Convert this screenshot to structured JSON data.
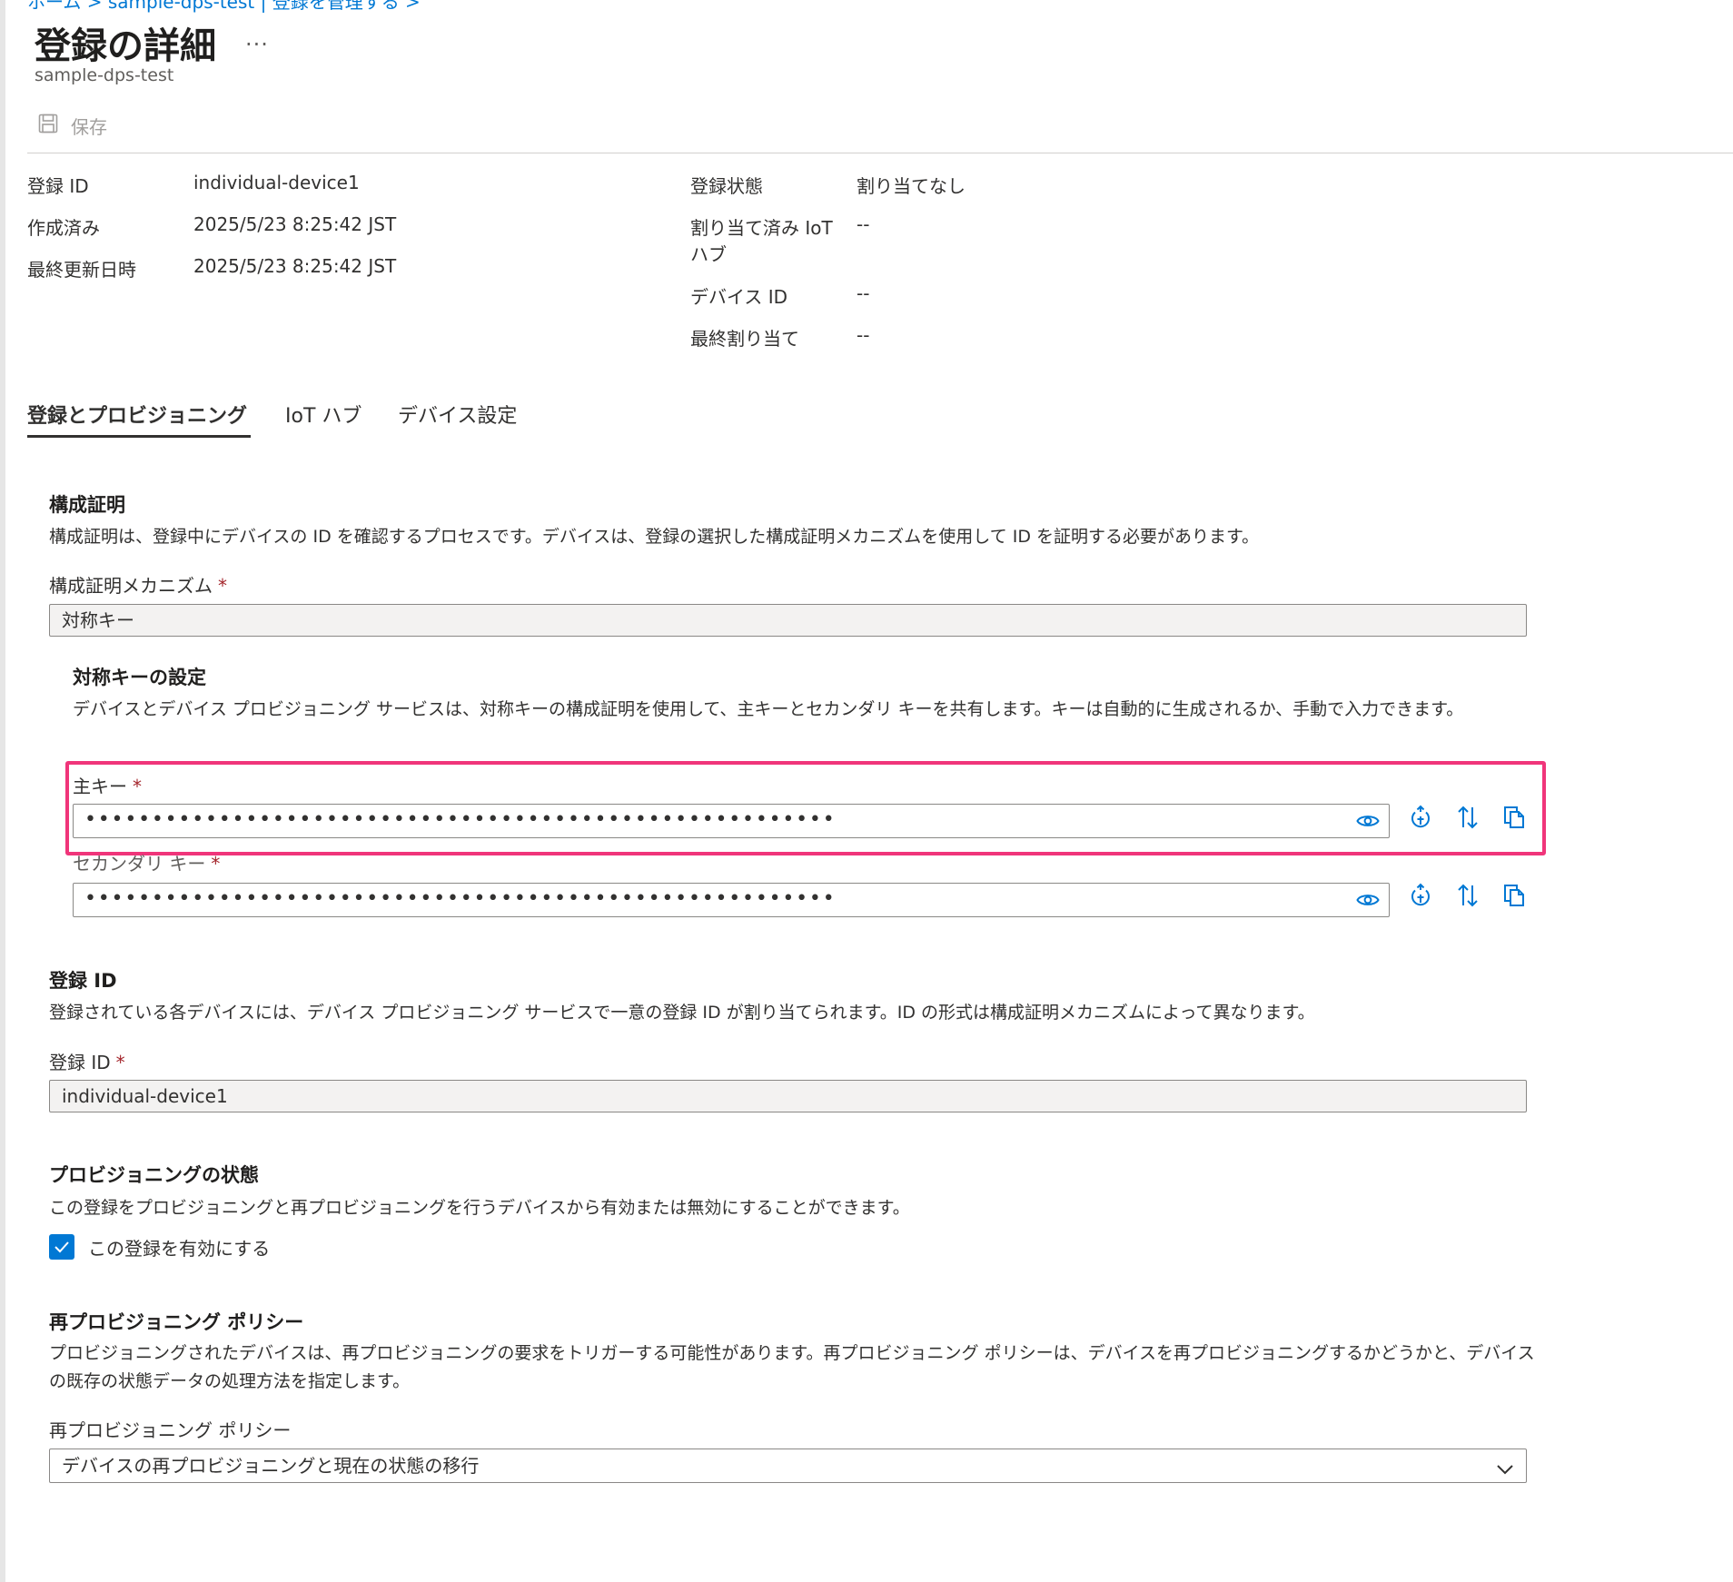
{
  "breadcrumb": {
    "text": "ホーム > sample-dps-test | 登録を管理する >"
  },
  "header": {
    "title": "登録の詳細",
    "more_label": "...",
    "subtitle": "sample-dps-test"
  },
  "toolbar": {
    "save_label": "保存"
  },
  "essentials": {
    "left": [
      {
        "label": "登録 ID",
        "value": "individual-device1"
      },
      {
        "label": "作成済み",
        "value": "2025/5/23 8:25:42 JST"
      },
      {
        "label": "最終更新日時",
        "value": "2025/5/23 8:25:42 JST"
      }
    ],
    "right": [
      {
        "label": "登録状態",
        "value": "割り当てなし"
      },
      {
        "label_line1": "割り当て済み IoT",
        "label_line2": "ハブ",
        "value": "--"
      },
      {
        "label": "デバイス ID",
        "value": "--"
      },
      {
        "label": "最終割り当て",
        "value": "--"
      }
    ]
  },
  "tabs": [
    {
      "label": "登録とプロビジョニング",
      "active": true
    },
    {
      "label": "IoT ハブ",
      "active": false
    },
    {
      "label": "デバイス設定",
      "active": false
    }
  ],
  "attestation": {
    "heading": "構成証明",
    "description": "構成証明は、登録中にデバイスの ID を確認するプロセスです。デバイスは、登録の選択した構成証明メカニズムを使用して ID を証明する必要があります。",
    "mechanism_label": "構成証明メカニズム",
    "required_mark": "*",
    "mechanism_value": "対称キー"
  },
  "symmetric": {
    "heading": "対称キーの設定",
    "description": "デバイスとデバイス プロビジョニング サービスは、対称キーの構成証明を使用して、主キーとセカンダリ キーを共有します。キーは自動的に生成されるか、手動で入力できます。",
    "primary_label": "主キー",
    "secondary_label": "セカンダリ キー",
    "required_mark": "*",
    "masked_value": "••••••••••••••••••••••••••••••••••••••••••••••••••••••••••••••••••••••••••••••••••••••••"
  },
  "registration_id": {
    "heading": "登録 ID",
    "description": "登録されている各デバイスには、デバイス プロビジョニング サービスで一意の登録 ID が割り当てられます。ID の形式は構成証明メカニズムによって異なります。",
    "label": "登録 ID",
    "required_mark": "*",
    "value": "individual-device1"
  },
  "provisioning_status": {
    "heading": "プロビジョニングの状態",
    "description": "この登録をプロビジョニングと再プロビジョニングを行うデバイスから有効または無効にすることができます。",
    "checkbox_label": "この登録を有効にする",
    "checked": true
  },
  "reprovision": {
    "heading": "再プロビジョニング ポリシー",
    "description": "プロビジョニングされたデバイスは、再プロビジョニングの要求をトリガーする可能性があります。再プロビジョニング ポリシーは、デバイスを再プロビジョニングするかどうかと、デバイスの既存の状態データの処理方法を指定します。",
    "label": "再プロビジョニング ポリシー",
    "selected": "デバイスの再プロビジョニングと現在の状態の移行"
  },
  "colors": {
    "accent": "#0078d4",
    "highlight": "#f0357a",
    "required": "#a4262c"
  },
  "icons": {
    "save": "save-icon",
    "show": "eye-icon",
    "regenerate": "regenerate-icon",
    "swap": "swap-icon",
    "copy": "copy-icon",
    "dropdown": "chevron-down-icon"
  }
}
